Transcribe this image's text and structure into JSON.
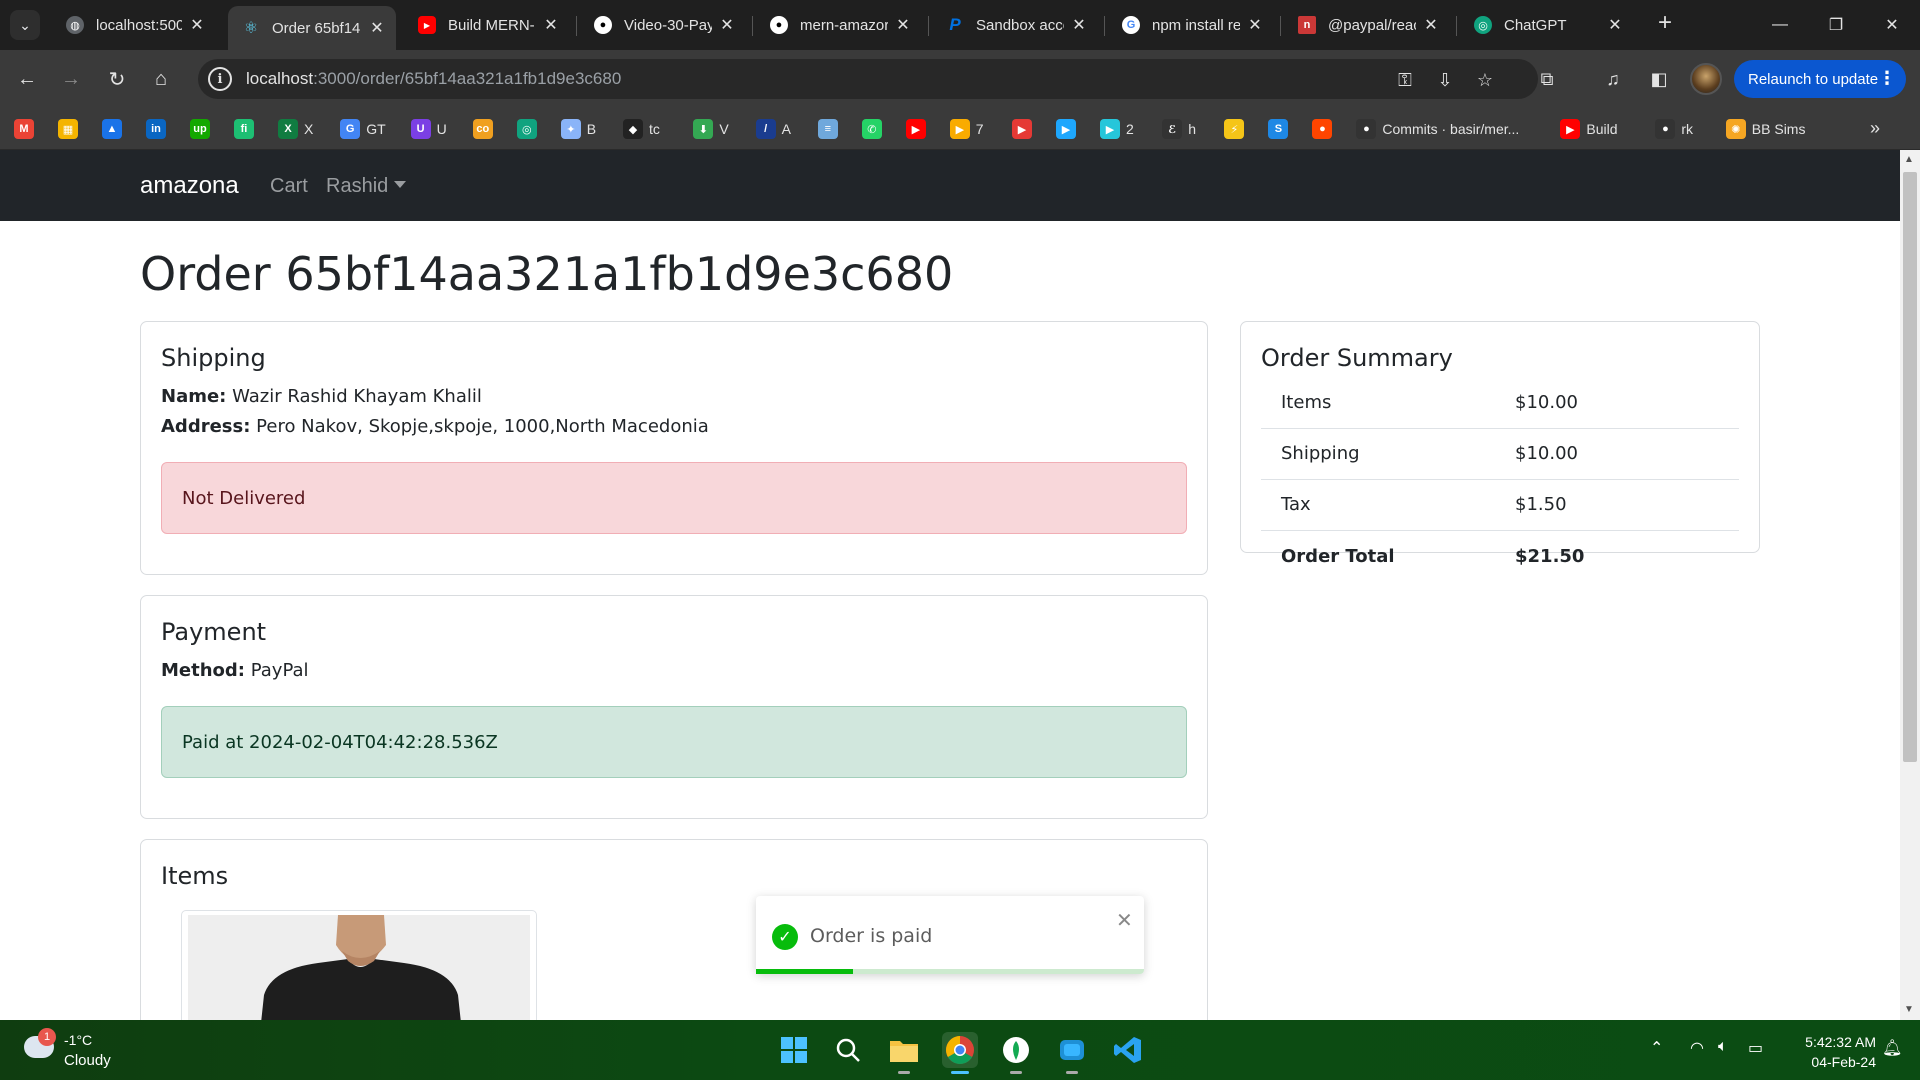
{
  "browser": {
    "tabs": [
      {
        "title": "localhost:500",
        "active": false,
        "icon": "globe-icon",
        "color": "#9aa0a6"
      },
      {
        "title": "Order 65bf14",
        "active": true,
        "icon": "react-icon",
        "color": "#61dafb"
      },
      {
        "title": "Build MERN-",
        "active": false,
        "icon": "youtube-icon",
        "color": "#ff0000"
      },
      {
        "title": "Video-30-Pay",
        "active": false,
        "icon": "github-icon",
        "color": "#ffffff"
      },
      {
        "title": "mern-amazor",
        "active": false,
        "icon": "github-icon",
        "color": "#ffffff"
      },
      {
        "title": "Sandbox acco",
        "active": false,
        "icon": "paypal-icon",
        "color": "#0070e0"
      },
      {
        "title": "npm install re",
        "active": false,
        "icon": "google-icon",
        "color": "#4285f4"
      },
      {
        "title": "@paypal/reac",
        "active": false,
        "icon": "npm-icon",
        "color": "#cb3837"
      },
      {
        "title": "ChatGPT",
        "active": false,
        "icon": "chatgpt-icon",
        "color": "#10a37f"
      }
    ],
    "url_host": "localhost",
    "url_rest": ":3000/order/65bf14aa321a1fb1d9e3c680",
    "relaunch_label": "Relaunch to update",
    "bookmarks": [
      {
        "label": "",
        "icon": "gmail-icon",
        "color": "#ea4335",
        "glyph": "M"
      },
      {
        "label": "",
        "icon": "sheets-icon",
        "color": "#f4b400",
        "glyph": "▦"
      },
      {
        "label": "",
        "icon": "drive-icon",
        "color": "#1a73e8",
        "glyph": "▲"
      },
      {
        "label": "",
        "icon": "linkedin-icon",
        "color": "#0a66c2",
        "glyph": "in"
      },
      {
        "label": "",
        "icon": "upwork-icon",
        "color": "#14a800",
        "glyph": "up"
      },
      {
        "label": "",
        "icon": "fiverr-icon",
        "color": "#1dbf73",
        "glyph": "fi"
      },
      {
        "label": "X",
        "icon": "excel-icon",
        "color": "#107c41",
        "glyph": "X"
      },
      {
        "label": "GT",
        "icon": "google-icon",
        "color": "#4285f4",
        "glyph": "G"
      },
      {
        "label": "U",
        "icon": "u-icon",
        "color": "#7b3fe4",
        "glyph": "U"
      },
      {
        "label": "",
        "icon": "coursera-icon",
        "color": "#f0a020",
        "glyph": "co"
      },
      {
        "label": "",
        "icon": "chatgpt-icon",
        "color": "#10a37f",
        "glyph": "◎"
      },
      {
        "label": "B",
        "icon": "gemini-icon",
        "color": "#8ab4f8",
        "glyph": "✦"
      },
      {
        "label": "tc",
        "icon": "tc-icon",
        "color": "#222222",
        "glyph": "◆"
      },
      {
        "label": "V",
        "icon": "download-icon",
        "color": "#34a853",
        "glyph": "⬇"
      },
      {
        "label": "A",
        "icon": "a-icon",
        "color": "#1a3c8f",
        "glyph": "/"
      },
      {
        "label": "",
        "icon": "stripes-icon",
        "color": "#6fa8dc",
        "glyph": "≡"
      },
      {
        "label": "",
        "icon": "whatsapp-icon",
        "color": "#25d366",
        "glyph": "✆"
      },
      {
        "label": "",
        "icon": "youtube-icon",
        "color": "#ff0000",
        "glyph": "▶"
      },
      {
        "label": "7",
        "icon": "yt-studio-icon",
        "color": "#f9ab00",
        "glyph": "▶"
      },
      {
        "label": "",
        "icon": "play-icon",
        "color": "#e53935",
        "glyph": "▶"
      },
      {
        "label": "",
        "icon": "play-blue-icon",
        "color": "#1ea7fd",
        "glyph": "▶"
      },
      {
        "label": "2",
        "icon": "play-cyan-icon",
        "color": "#26c6da",
        "glyph": "▶"
      },
      {
        "label": "h",
        "icon": "e-icon",
        "color": "#333333",
        "glyph": "ℰ"
      },
      {
        "label": "",
        "icon": "bolt-icon",
        "color": "#f5c518",
        "glyph": "⚡"
      },
      {
        "label": "",
        "icon": "s-icon",
        "color": "#1e88e5",
        "glyph": "S"
      },
      {
        "label": "",
        "icon": "reddit-icon",
        "color": "#ff4500",
        "glyph": "●"
      },
      {
        "label": "Commits · basir/mer...",
        "icon": "github-icon",
        "color": "#333333",
        "glyph": "●"
      },
      {
        "label": "Build",
        "icon": "youtube-icon",
        "color": "#ff0000",
        "glyph": "▶"
      },
      {
        "label": "rk",
        "icon": "github-icon",
        "color": "#333333",
        "glyph": "●"
      },
      {
        "label": "BB Sims",
        "icon": "sun-icon",
        "color": "#f5a623",
        "glyph": "✺"
      }
    ]
  },
  "site": {
    "brand": "amazona",
    "nav_cart": "Cart",
    "nav_user": "Rashid"
  },
  "order": {
    "title": "Order 65bf14aa321a1fb1d9e3c680",
    "shipping": {
      "heading": "Shipping",
      "name_label": "Name:",
      "name": "Wazir Rashid Khayam Khalil",
      "address_label": "Address:",
      "address": "Pero Nakov, Skopje,skpoje, 1000,North Macedonia",
      "status": "Not Delivered"
    },
    "payment": {
      "heading": "Payment",
      "method_label": "Method:",
      "method": "PayPal",
      "status": "Paid at 2024-02-04T04:42:28.536Z"
    },
    "items": {
      "heading": "Items"
    },
    "summary": {
      "heading": "Order Summary",
      "rows": [
        {
          "label": "Items",
          "value": "$10.00"
        },
        {
          "label": "Shipping",
          "value": "$10.00"
        },
        {
          "label": "Tax",
          "value": "$1.50"
        },
        {
          "label": "Order Total",
          "value": "$21.50"
        }
      ]
    }
  },
  "toast": {
    "message": "Order is paid",
    "progress": 0.25
  },
  "taskbar": {
    "weather_temp": "-1°C",
    "weather_condition": "Cloudy",
    "weather_badge": "1",
    "time": "5:42:32 AM",
    "date": "04-Feb-24"
  }
}
